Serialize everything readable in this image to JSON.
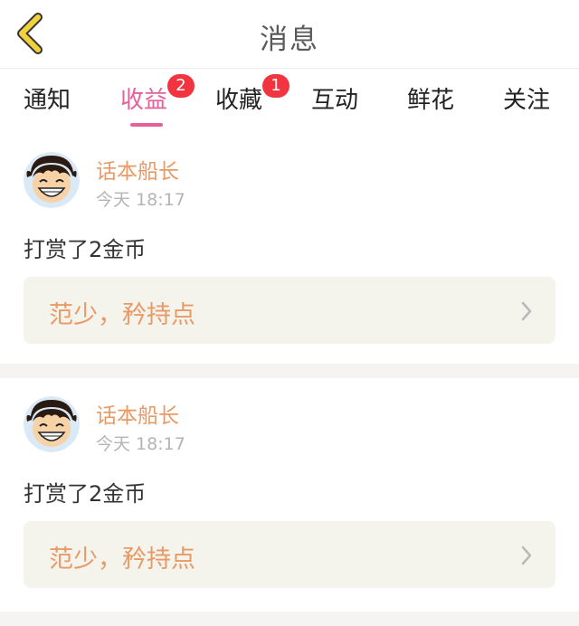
{
  "header": {
    "title": "消息",
    "back_icon": "chevron-left-icon",
    "back_color": "#f2d23c"
  },
  "tabs": [
    {
      "label": "通知",
      "badge": "",
      "active": false
    },
    {
      "label": "收益",
      "badge": "2",
      "active": true
    },
    {
      "label": "收藏",
      "badge": "1",
      "active": false
    },
    {
      "label": "互动",
      "badge": "",
      "active": false
    },
    {
      "label": "鲜花",
      "badge": "",
      "active": false
    },
    {
      "label": "关注",
      "badge": "",
      "active": false
    }
  ],
  "colors": {
    "accent_pink": "#e5609a",
    "badge_red": "#f1343f",
    "name_orange": "#e89a66",
    "quote_bg": "#f4f3ec"
  },
  "messages": [
    {
      "username": "话本船长",
      "time": "今天 18:17",
      "action": "打赏了2金币",
      "quote": "范少，矜持点"
    },
    {
      "username": "话本船长",
      "time": "今天 18:17",
      "action": "打赏了2金币",
      "quote": "范少，矜持点"
    }
  ]
}
